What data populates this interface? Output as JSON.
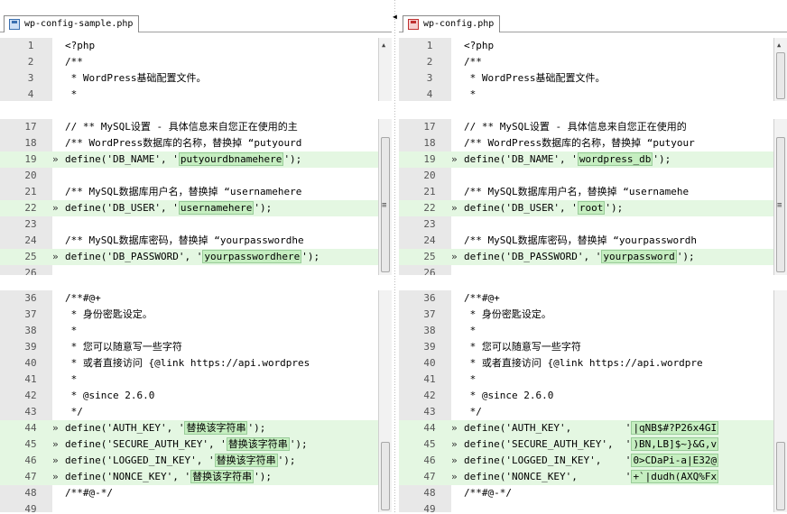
{
  "left": {
    "tab": "wp-config-sample.php",
    "block1": [
      {
        "n": "1",
        "m": "",
        "code": "<?php",
        "diff": false
      },
      {
        "n": "2",
        "m": "",
        "code": "/**",
        "diff": false
      },
      {
        "n": "3",
        "m": "",
        "code": " * WordPress基础配置文件。",
        "diff": false
      },
      {
        "n": "4",
        "m": "",
        "code": " *",
        "diff": false
      }
    ],
    "block2": [
      {
        "n": "17",
        "m": "",
        "code": "// ** MySQL设置 - 具体信息来自您正在使用的主",
        "diff": false
      },
      {
        "n": "18",
        "m": "",
        "code": "/** WordPress数据库的名称，替换掉 “putyourd",
        "diff": false
      },
      {
        "n": "19",
        "m": "»",
        "pre": "define('DB_NAME', '",
        "val": "putyourdbnamehere",
        "post": "');",
        "diff": true
      },
      {
        "n": "20",
        "m": "",
        "code": "",
        "diff": false
      },
      {
        "n": "21",
        "m": "",
        "code": "/** MySQL数据库用户名，替换掉 “usernamehere",
        "diff": false
      },
      {
        "n": "22",
        "m": "»",
        "pre": "define('DB_USER', '",
        "val": "usernamehere",
        "post": "');",
        "diff": true
      },
      {
        "n": "23",
        "m": "",
        "code": "",
        "diff": false
      },
      {
        "n": "24",
        "m": "",
        "code": "/** MySQL数据库密码，替换掉 “yourpasswordhe",
        "diff": false
      },
      {
        "n": "25",
        "m": "»",
        "pre": "define('DB_PASSWORD', '",
        "val": "yourpasswordhere",
        "post": "');",
        "diff": true
      },
      {
        "n": "26",
        "m": "",
        "code": "",
        "diff": false
      }
    ],
    "block3": [
      {
        "n": "36",
        "m": "",
        "code": "/**#@+",
        "diff": false
      },
      {
        "n": "37",
        "m": "",
        "code": " * 身份密匙设定。",
        "diff": false
      },
      {
        "n": "38",
        "m": "",
        "code": " *",
        "diff": false
      },
      {
        "n": "39",
        "m": "",
        "code": " * 您可以随意写一些字符",
        "diff": false
      },
      {
        "n": "40",
        "m": "",
        "code": " * 或者直接访问 {@link https://api.wordpres",
        "diff": false
      },
      {
        "n": "41",
        "m": "",
        "code": " *",
        "diff": false
      },
      {
        "n": "42",
        "m": "",
        "code": " * @since 2.6.0",
        "diff": false
      },
      {
        "n": "43",
        "m": "",
        "code": " */",
        "diff": false
      },
      {
        "n": "44",
        "m": "»",
        "pre": "define('AUTH_KEY', '",
        "val": "替换该字符串",
        "post": "');",
        "diff": true
      },
      {
        "n": "45",
        "m": "»",
        "pre": "define('SECURE_AUTH_KEY', '",
        "val": "替换该字符串",
        "post": "');",
        "diff": true
      },
      {
        "n": "46",
        "m": "»",
        "pre": "define('LOGGED_IN_KEY', '",
        "val": "替换该字符串",
        "post": "');",
        "diff": true
      },
      {
        "n": "47",
        "m": "»",
        "pre": "define('NONCE_KEY', '",
        "val": "替换该字符串",
        "post": "');",
        "diff": true
      },
      {
        "n": "48",
        "m": "",
        "code": "/**#@-*/",
        "diff": false
      },
      {
        "n": "49",
        "m": "",
        "code": "",
        "diff": false
      }
    ]
  },
  "right": {
    "tab": "wp-config.php",
    "block1": [
      {
        "n": "1",
        "m": "",
        "code": "<?php",
        "diff": false
      },
      {
        "n": "2",
        "m": "",
        "code": "/**",
        "diff": false
      },
      {
        "n": "3",
        "m": "",
        "code": " * WordPress基础配置文件。",
        "diff": false
      },
      {
        "n": "4",
        "m": "",
        "code": " *",
        "diff": false
      }
    ],
    "block2": [
      {
        "n": "17",
        "m": "",
        "code": "// ** MySQL设置 - 具体信息来自您正在使用的",
        "diff": false
      },
      {
        "n": "18",
        "m": "",
        "code": "/** WordPress数据库的名称，替换掉 “putyour",
        "diff": false
      },
      {
        "n": "19",
        "m": "»",
        "pre": "define('DB_NAME', '",
        "val": "wordpress_db",
        "post": "');",
        "diff": true
      },
      {
        "n": "20",
        "m": "",
        "code": "",
        "diff": false
      },
      {
        "n": "21",
        "m": "",
        "code": "/** MySQL数据库用户名，替换掉 “usernamehe",
        "diff": false
      },
      {
        "n": "22",
        "m": "»",
        "pre": "define('DB_USER', '",
        "val": "root",
        "post": "');",
        "diff": true
      },
      {
        "n": "23",
        "m": "",
        "code": "",
        "diff": false
      },
      {
        "n": "24",
        "m": "",
        "code": "/** MySQL数据库密码，替换掉 “yourpasswordh",
        "diff": false
      },
      {
        "n": "25",
        "m": "»",
        "pre": "define('DB_PASSWORD', '",
        "val": "yourpassword",
        "post": "');",
        "diff": true
      },
      {
        "n": "26",
        "m": "",
        "code": "",
        "diff": false
      }
    ],
    "block3": [
      {
        "n": "36",
        "m": "",
        "code": "/**#@+",
        "diff": false
      },
      {
        "n": "37",
        "m": "",
        "code": " * 身份密匙设定。",
        "diff": false
      },
      {
        "n": "38",
        "m": "",
        "code": " *",
        "diff": false
      },
      {
        "n": "39",
        "m": "",
        "code": " * 您可以随意写一些字符",
        "diff": false
      },
      {
        "n": "40",
        "m": "",
        "code": " * 或者直接访问 {@link https://api.wordpre",
        "diff": false
      },
      {
        "n": "41",
        "m": "",
        "code": " *",
        "diff": false
      },
      {
        "n": "42",
        "m": "",
        "code": " * @since 2.6.0",
        "diff": false
      },
      {
        "n": "43",
        "m": "",
        "code": " */",
        "diff": false
      },
      {
        "n": "44",
        "m": "»",
        "pre": "define('AUTH_KEY',         '",
        "val": "|qNB$#?P26x4GI",
        "post": "",
        "diff": true
      },
      {
        "n": "45",
        "m": "»",
        "pre": "define('SECURE_AUTH_KEY',  '",
        "val": ")BN,LB]$~}&G,v",
        "post": "",
        "diff": true
      },
      {
        "n": "46",
        "m": "»",
        "pre": "define('LOGGED_IN_KEY',    '",
        "val": "0>CDaPi-a|E32@",
        "post": "",
        "diff": true
      },
      {
        "n": "47",
        "m": "»",
        "pre": "define('NONCE_KEY',        '",
        "val": "+`|dudh(AXQ%Fx",
        "post": "",
        "diff": true
      },
      {
        "n": "48",
        "m": "",
        "code": "/**#@-*/",
        "diff": false
      },
      {
        "n": "49",
        "m": "",
        "code": "",
        "diff": false
      }
    ]
  },
  "icons": {
    "file": "file-icon",
    "scroll_up": "▲",
    "scroll_down": "▼",
    "splitter": "◀",
    "scroll_mid": "≡"
  }
}
